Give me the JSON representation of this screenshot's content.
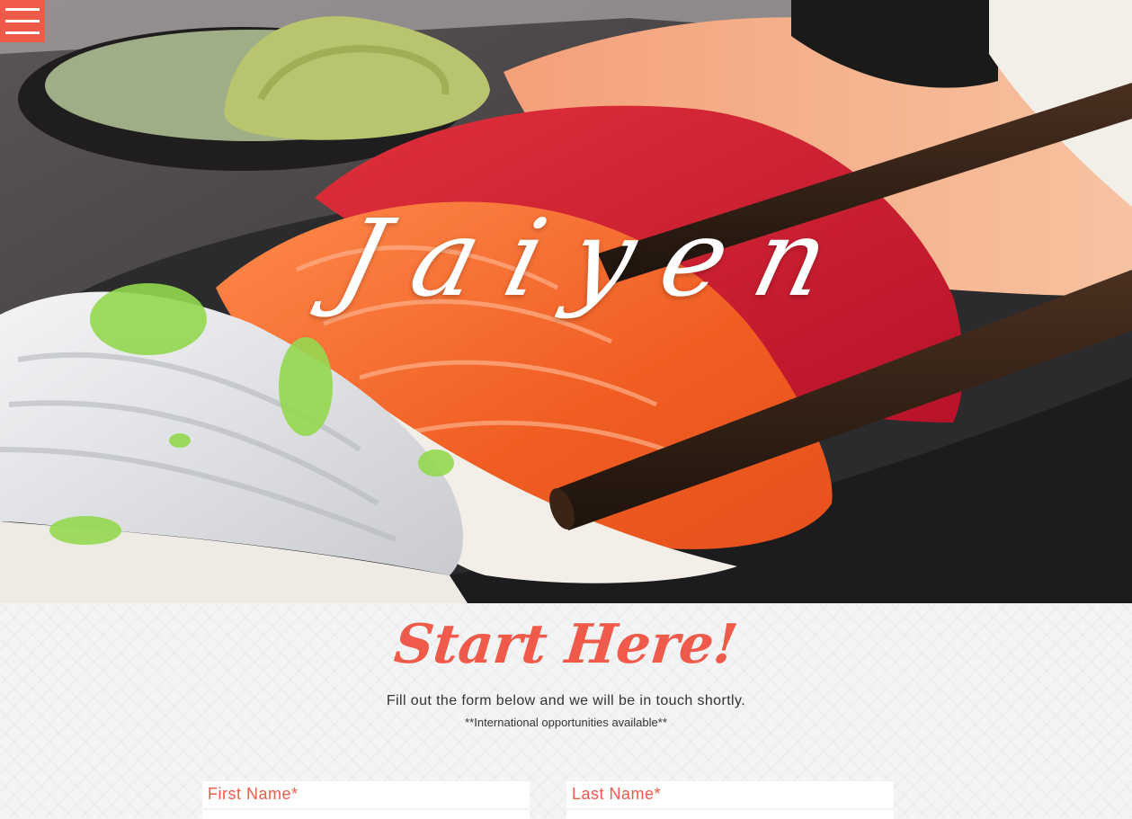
{
  "header": {
    "brand_title": "Jaiyen",
    "menu_icon": "hamburger-menu-icon"
  },
  "hero": {
    "image_subject": "sushi-nigiri-with-chopsticks"
  },
  "form_section": {
    "heading": "Start Here!",
    "subtitle": "Fill out the form below and we will be in touch shortly.",
    "note": "**International opportunities available**",
    "fields": {
      "first_name": {
        "label": "First Name*",
        "value": ""
      },
      "last_name": {
        "label": "Last Name*",
        "value": ""
      }
    }
  },
  "colors": {
    "accent": "#ef5a4a",
    "section_bg": "#f3f4f5",
    "text": "#333333"
  }
}
